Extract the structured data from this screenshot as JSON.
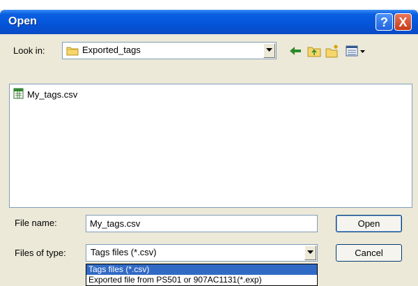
{
  "window": {
    "title": "Open",
    "help_glyph": "?",
    "close_glyph": "X"
  },
  "toolbar": {
    "look_in_label": "Look in:",
    "look_in_value": "Exported_tags",
    "icons": [
      "back-arrow-icon",
      "up-folder-icon",
      "new-folder-icon",
      "view-menu-icon"
    ]
  },
  "files": [
    {
      "name": "My_tags.csv",
      "icon": "csv-file-icon"
    }
  ],
  "form": {
    "file_name_label": "File name:",
    "file_name_value": "My_tags.csv",
    "files_of_type_label": "Files of type:",
    "files_of_type_value": "Tags files (*.csv)"
  },
  "buttons": {
    "open": "Open",
    "cancel": "Cancel"
  },
  "type_dropdown": {
    "options": [
      "Tags files (*.csv)",
      "Exported file from PS501 or 907AC1131(*.exp)"
    ],
    "selected_index": 0
  },
  "colors": {
    "titlebar": "#0454d9",
    "selection": "#316ac5",
    "dialog_bg": "#ece9d8"
  }
}
